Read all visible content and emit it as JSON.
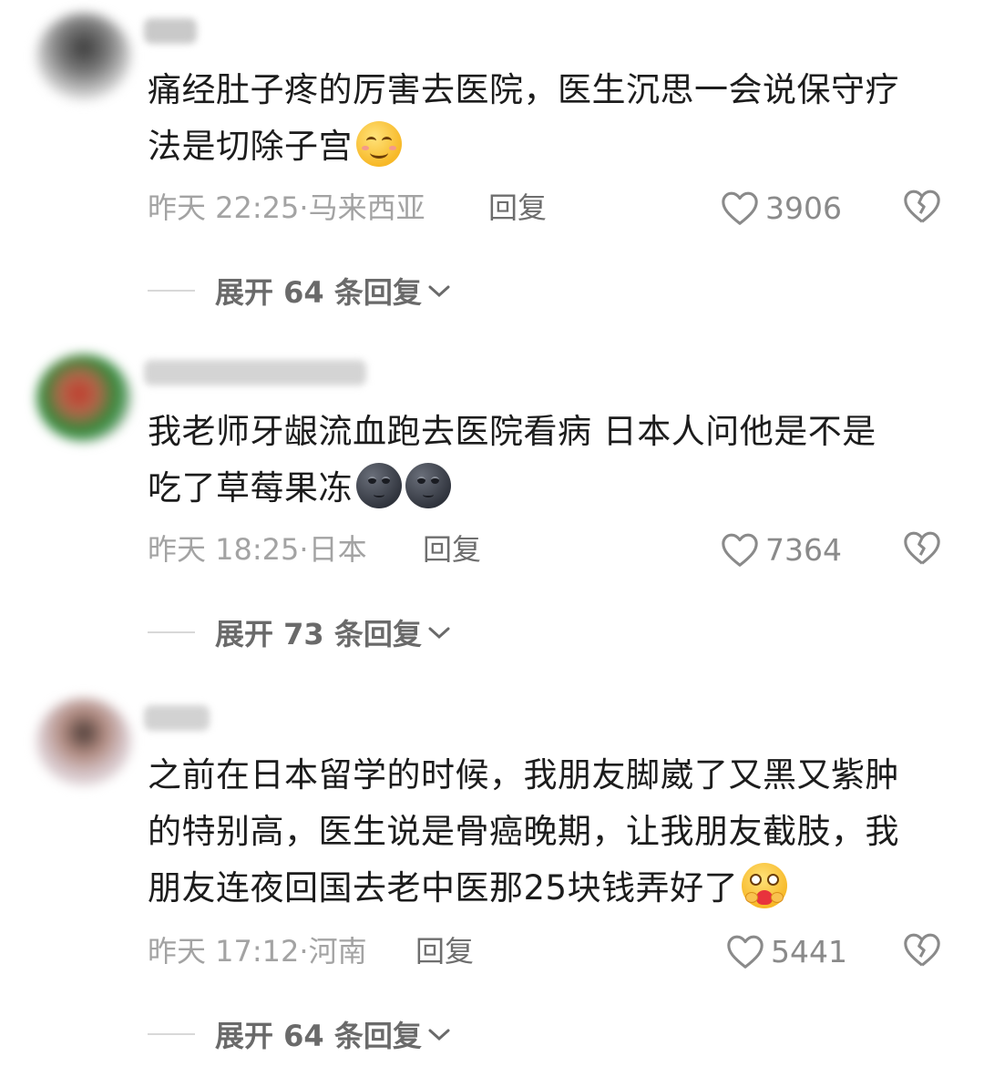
{
  "comments": [
    {
      "text_line1": "痛经肚子疼的厉害去医院，医生沉思一会说保守疗",
      "text_line2": "法是切除子宫",
      "emoji": [
        "smiling-face-icon"
      ],
      "time": "昨天 22:25",
      "location": "马来西亚",
      "reply_label": "回复",
      "likes": "3906",
      "expand_label": "展开 64 条回复"
    },
    {
      "text_line1": "我老师牙龈流血跑去医院看病 日本人问他是不是",
      "text_line2": "吃了草莓果冻",
      "emoji": [
        "new-moon-face-icon",
        "new-moon-face-icon"
      ],
      "time": "昨天 18:25",
      "location": "日本",
      "reply_label": "回复",
      "likes": "7364",
      "expand_label": "展开 73 条回复"
    },
    {
      "text_line1": "之前在日本留学的时候，我朋友脚崴了又黑又紫肿",
      "text_line2": "的特别高，医生说是骨癌晚期，让我朋友截肢，我",
      "text_line3": "朋友连夜回国去老中医那25块钱弄好了",
      "emoji": [
        "hugging-face-icon"
      ],
      "time": "昨天 17:12",
      "location": "河南",
      "reply_label": "回复",
      "likes": "5441",
      "expand_label": "展开 64 条回复"
    }
  ],
  "colors": {
    "text": "#1c1c1c",
    "meta": "#a3a3a3",
    "icon": "#8a8a8a"
  }
}
